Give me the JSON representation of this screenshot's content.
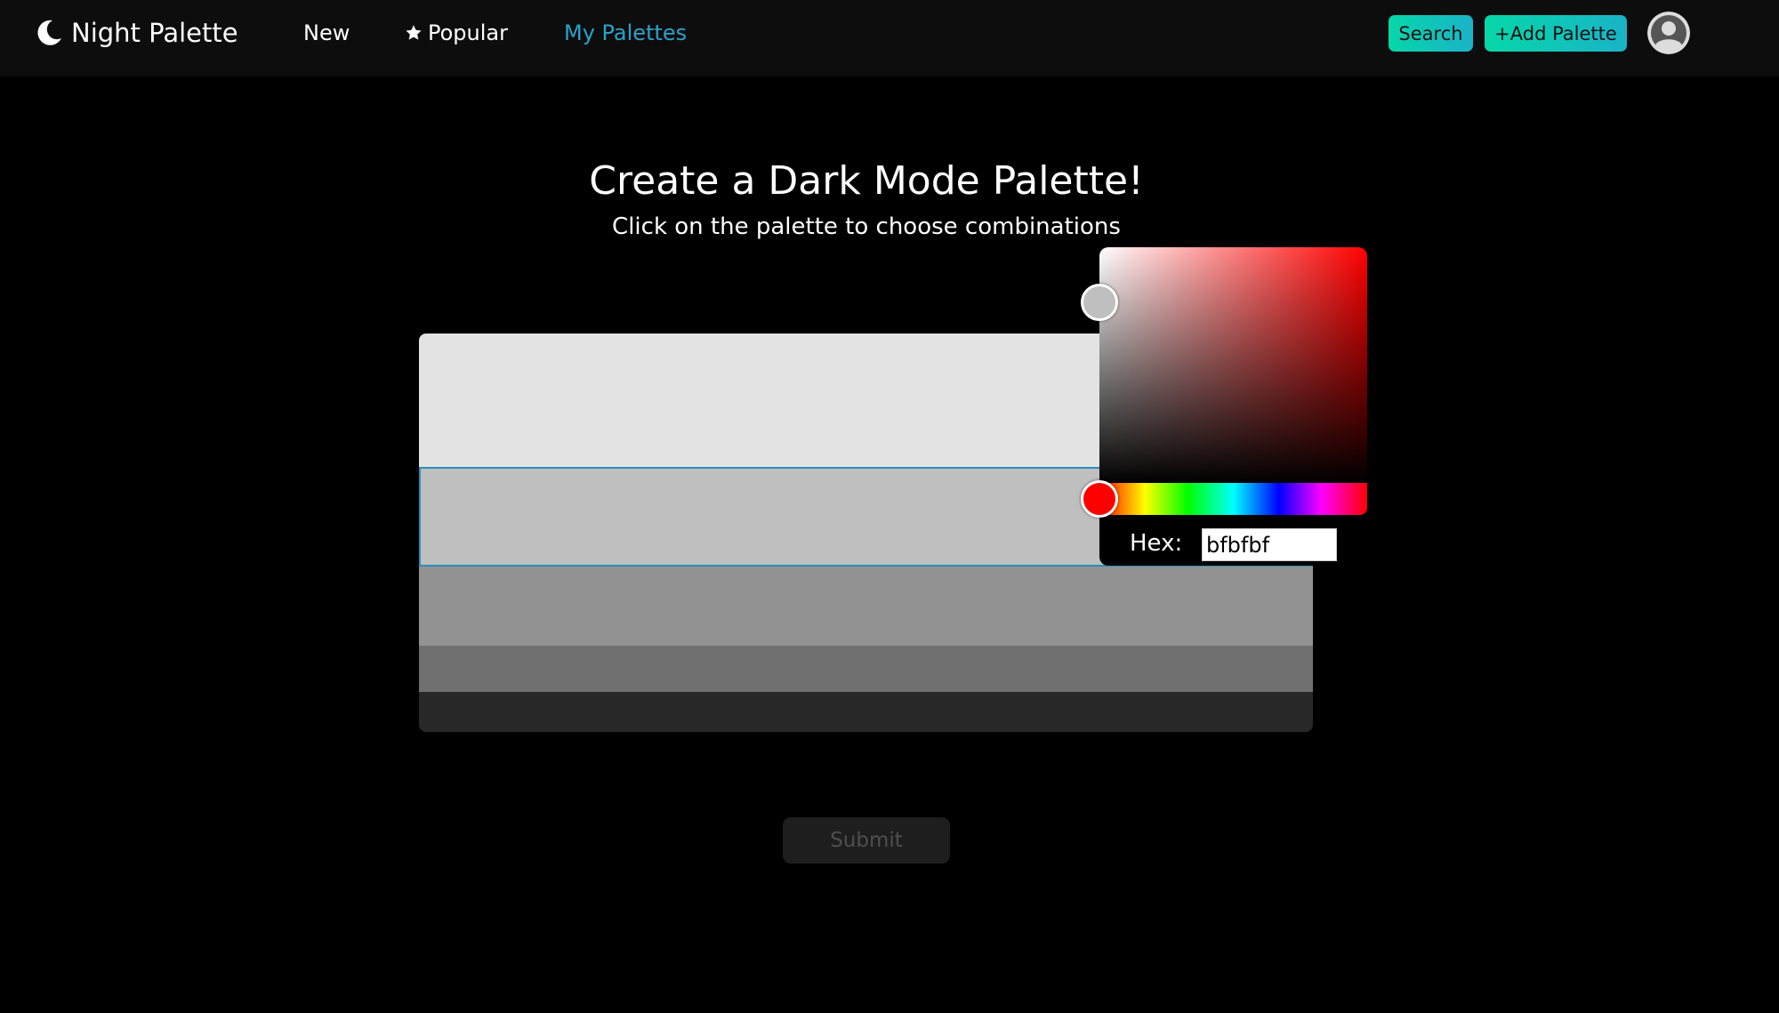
{
  "navbar": {
    "brand": "Night Palette",
    "brand_icon": "moon-icon",
    "links": {
      "new": "New",
      "popular": "Popular",
      "popular_icon": "star-icon",
      "my_palettes": "My Palettes"
    },
    "search_label": "Search",
    "add_palette_label": "+Add Palette",
    "avatar_icon": "user-avatar-icon",
    "active_link_color": "#2aa3c9",
    "button_gradient": [
      "#06d7a8",
      "#1ab3c8"
    ]
  },
  "main": {
    "title": "Create a Dark Mode Palette!",
    "subtitle": "Click on the palette to choose combinations"
  },
  "palette": {
    "swatches": [
      {
        "color": "#e3e3e3"
      },
      {
        "color": "#bfbfbf",
        "selected": true
      },
      {
        "color": "#929292"
      },
      {
        "color": "#707070"
      },
      {
        "color": "#282828"
      }
    ]
  },
  "picker": {
    "hex_label": "Hex:",
    "hex_value": "bfbfbf",
    "hue_color": "#ff0000"
  },
  "submit": {
    "label": "Submit"
  }
}
